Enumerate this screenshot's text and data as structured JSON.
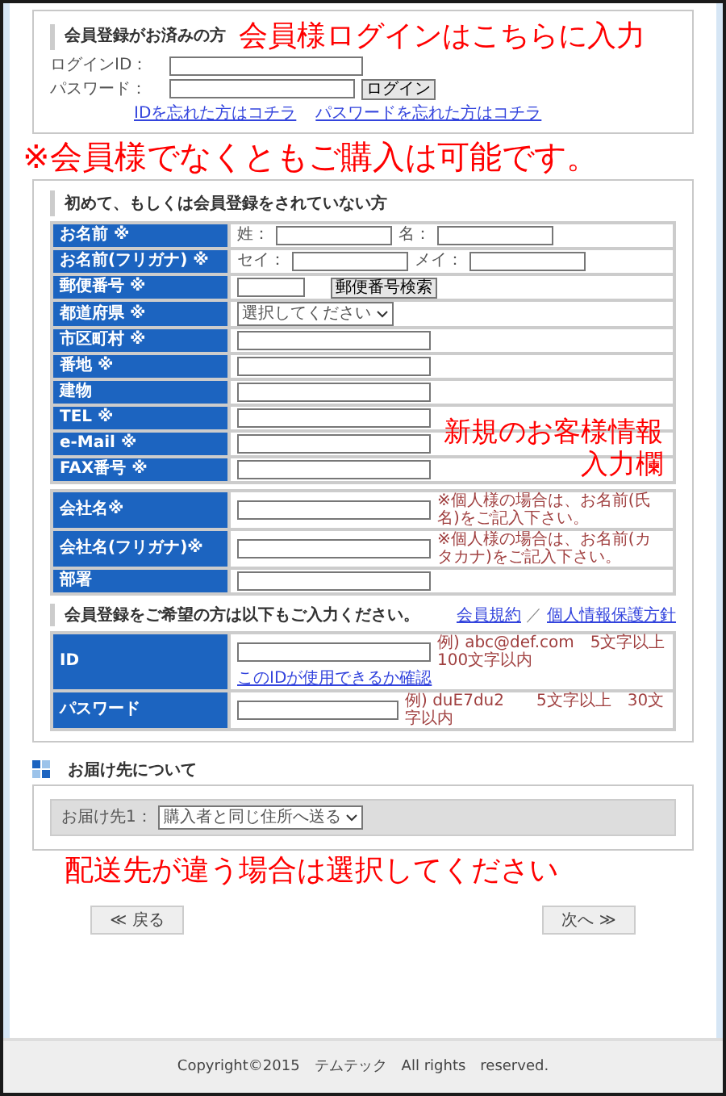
{
  "login": {
    "heading": "会員登録がお済みの方",
    "fields": [
      {
        "label": "ログインID："
      },
      {
        "label": "パスワード："
      }
    ],
    "button": "ログイン",
    "links": [
      "IDを忘れた方はコチラ",
      "パスワードを忘れた方はコチラ"
    ]
  },
  "new_customer": {
    "heading": "初めて、もしくは会員登録をされていない方",
    "rows": [
      {
        "label": "お名前 ※",
        "kind": "pair",
        "parts": [
          "姓：",
          "名："
        ]
      },
      {
        "label": "お名前(フリガナ) ※",
        "kind": "pair",
        "parts": [
          "セイ：",
          "メイ："
        ]
      },
      {
        "label": "郵便番号 ※",
        "kind": "postal",
        "button": "郵便番号検索"
      },
      {
        "label": "都道府県 ※",
        "kind": "select",
        "value": "選択してください"
      },
      {
        "label": "市区町村 ※",
        "kind": "text"
      },
      {
        "label": "番地 ※",
        "kind": "text"
      },
      {
        "label": "建物",
        "kind": "text"
      },
      {
        "label": "TEL ※",
        "kind": "text"
      },
      {
        "label": "e-Mail ※",
        "kind": "text"
      },
      {
        "label": "FAX番号 ※",
        "kind": "text"
      }
    ],
    "company_rows": [
      {
        "label": "会社名※",
        "kind": "text",
        "note": "※個人様の場合は、お名前(氏名)をご記入下さい。"
      },
      {
        "label": "会社名(フリガナ)※",
        "kind": "text",
        "note": "※個人様の場合は、お名前(カタカナ)をご記入下さい。"
      },
      {
        "label": "部署",
        "kind": "text"
      }
    ],
    "member_intro": "会員登録をご希望の方は以下もご入力ください。",
    "member_links": [
      "会員規約",
      "／",
      "個人情報保護方針"
    ],
    "member_rows": [
      {
        "label": "ID",
        "kind": "id",
        "note": "例) abc@def.com　5文字以上　100文字以内",
        "link": "このIDが使用できるか確認"
      },
      {
        "label": "パスワード",
        "kind": "short",
        "note": "例) duE7du2　　5文字以上　30文字以内"
      }
    ]
  },
  "delivery": {
    "heading": "お届け先について",
    "label": "お届け先1：",
    "value": "購入者と同じ住所へ送る"
  },
  "buttons": [
    "≪ 戻る",
    "次へ ≫"
  ],
  "footer": "Copyright©2015　テムテック　All rights　reserved.",
  "annotations": [
    {
      "kind": "login",
      "text": "会員様ログインはこちらに入力"
    },
    {
      "kind": "notice",
      "text": "※会員様でなくともご購入は可能です。"
    },
    {
      "kind": "form",
      "text": "新規のお客様情報"
    },
    {
      "kind": "form2",
      "text": "入力欄"
    },
    {
      "kind": "delivery",
      "text": "配送先が違う場合は選択してください"
    }
  ]
}
